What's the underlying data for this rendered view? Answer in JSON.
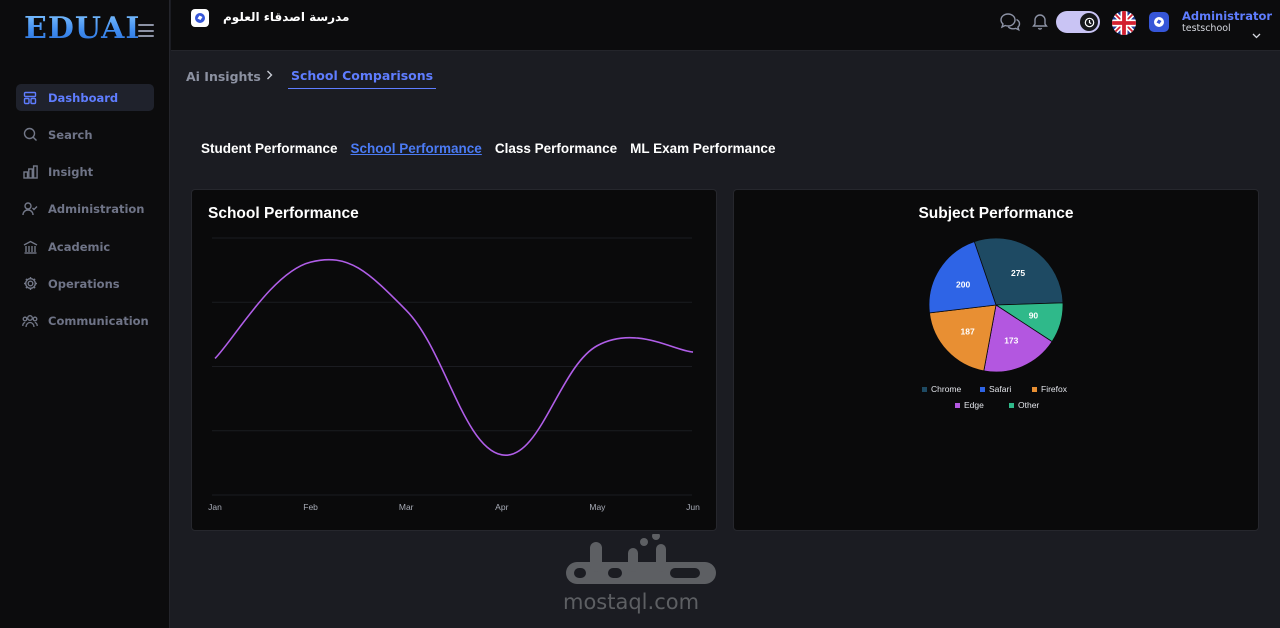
{
  "app": {
    "logo": "EDUAI"
  },
  "sidebar": {
    "items": [
      {
        "label": "Dashboard",
        "icon": "dashboard-icon",
        "active": true
      },
      {
        "label": "Search",
        "icon": "search-icon"
      },
      {
        "label": "Insight",
        "icon": "bar-chart-icon"
      },
      {
        "label": "Administration",
        "icon": "user-check-icon"
      },
      {
        "label": "Academic",
        "icon": "building-icon"
      },
      {
        "label": "Operations",
        "icon": "gear-icon"
      },
      {
        "label": "Communication",
        "icon": "people-icon"
      }
    ]
  },
  "topbar": {
    "school_name": "مدرسة اصدقاء العلوم",
    "user_role": "Administrator",
    "user_school": "testschool"
  },
  "breadcrumb": {
    "parent": "Ai Insights",
    "current": "School Comparisons"
  },
  "tabs": [
    {
      "label": "Student Performance"
    },
    {
      "label": "School Performance",
      "active": true
    },
    {
      "label": "Class Performance"
    },
    {
      "label": "ML Exam Performance"
    }
  ],
  "watermark": {
    "text": "mostaql.com"
  },
  "colors": {
    "accent": "#5f7dff",
    "line": "#b05ee8",
    "chrome": "#1e4a63",
    "safari": "#2e64e6",
    "firefox": "#e88f33",
    "edge": "#b357e0",
    "other": "#2fb98a"
  },
  "chart_data": [
    {
      "type": "line",
      "title": "School Performance",
      "categories": [
        "Jan",
        "Feb",
        "Mar",
        "Apr",
        "May",
        "Jun"
      ],
      "values": [
        40,
        100,
        70,
        -20,
        48,
        44
      ],
      "ylim": [
        -45,
        115
      ],
      "grid": true,
      "smooth": true
    },
    {
      "type": "pie",
      "title": "Subject Performance",
      "labels": [
        "Chrome",
        "Safari",
        "Firefox",
        "Edge",
        "Other"
      ],
      "values": [
        275,
        200,
        187,
        173,
        90
      ],
      "legend": "bottom"
    }
  ]
}
